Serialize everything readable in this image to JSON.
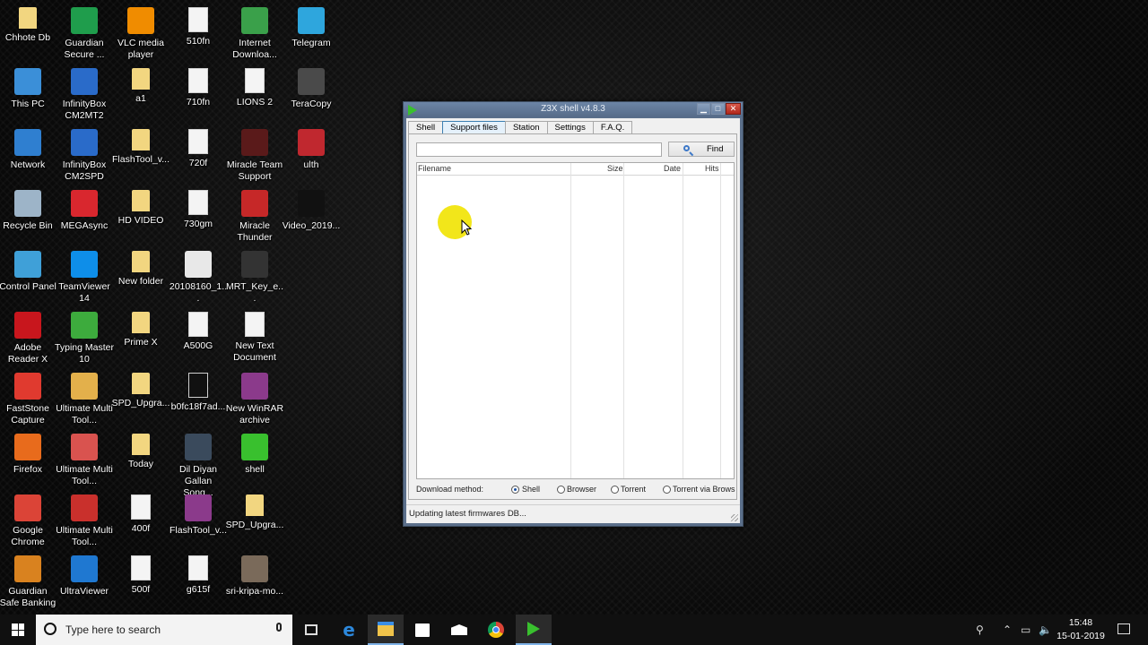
{
  "desktop": {
    "icons": [
      {
        "label": "Chhote Db",
        "icon": "folder-user-icon",
        "color": "#f2d680"
      },
      {
        "label": "This PC",
        "icon": "this-pc-icon",
        "color": "#3b8fd8"
      },
      {
        "label": "Network",
        "icon": "network-icon",
        "color": "#2f7fd0"
      },
      {
        "label": "Recycle Bin",
        "icon": "recycle-bin-icon",
        "color": "#9db4c8"
      },
      {
        "label": "Control Panel",
        "icon": "control-panel-icon",
        "color": "#3fa0d8"
      },
      {
        "label": "Adobe Reader X",
        "icon": "adobe-reader-icon",
        "color": "#c8161d"
      },
      {
        "label": "FastStone Capture",
        "icon": "faststone-icon",
        "color": "#e03a2f"
      },
      {
        "label": "Firefox",
        "icon": "firefox-icon",
        "color": "#e86b1c"
      },
      {
        "label": "Google Chrome",
        "icon": "chrome-icon",
        "color": "#db4437"
      },
      {
        "label": "Guardian Safe Banking",
        "icon": "guardian-banking-icon",
        "color": "#d9821f"
      },
      {
        "label": "Guardian Secure ...",
        "icon": "guardian-secure-icon",
        "color": "#1f9d4c"
      },
      {
        "label": "InfinityBox CM2MT2",
        "icon": "infinitybox-icon",
        "color": "#2a6bc9"
      },
      {
        "label": "InfinityBox CM2SPD",
        "icon": "infinitybox-icon",
        "color": "#2a6bc9"
      },
      {
        "label": "MEGAsync",
        "icon": "megasync-icon",
        "color": "#d9272e"
      },
      {
        "label": "TeamViewer 14",
        "icon": "teamviewer-icon",
        "color": "#0e8ee9"
      },
      {
        "label": "Typing Master 10",
        "icon": "typing-master-icon",
        "color": "#3dab3d"
      },
      {
        "label": "Ultimate Multi Tool...",
        "icon": "ultimate-multi-tool-icon",
        "color": "#e3b04b"
      },
      {
        "label": "Ultimate Multi Tool...",
        "icon": "ultimate-multi-tool-icon",
        "color": "#d9534f"
      },
      {
        "label": "Ultimate Multi Tool...",
        "icon": "ultimate-multi-tool-icon",
        "color": "#c9302c"
      },
      {
        "label": "UltraViewer",
        "icon": "ultraviewer-icon",
        "color": "#1f78d1"
      },
      {
        "label": "VLC media player",
        "icon": "vlc-icon",
        "color": "#f08c00"
      },
      {
        "label": "a1",
        "icon": "folder-icon",
        "color": "#f2d680"
      },
      {
        "label": "FlashTool_v...",
        "icon": "folder-icon",
        "color": "#f2d680"
      },
      {
        "label": "HD VIDEO",
        "icon": "folder-icon",
        "color": "#f2d680"
      },
      {
        "label": "New folder",
        "icon": "folder-icon",
        "color": "#f2d680"
      },
      {
        "label": "Prime X",
        "icon": "folder-icon",
        "color": "#f2d680"
      },
      {
        "label": "SPD_Upgra...",
        "icon": "folder-icon",
        "color": "#f2d680"
      },
      {
        "label": "Today",
        "icon": "folder-icon",
        "color": "#f2d680"
      },
      {
        "label": "400f",
        "icon": "file-icon",
        "color": "#f4f4f4"
      },
      {
        "label": "500f",
        "icon": "file-icon",
        "color": "#f4f4f4"
      },
      {
        "label": "510fn",
        "icon": "file-icon",
        "color": "#f4f4f4"
      },
      {
        "label": "710fn",
        "icon": "file-icon",
        "color": "#f4f4f4"
      },
      {
        "label": "720f",
        "icon": "file-icon",
        "color": "#f4f4f4"
      },
      {
        "label": "730gm",
        "icon": "file-icon",
        "color": "#f4f4f4"
      },
      {
        "label": "20108160_1...",
        "icon": "image-file-icon",
        "color": "#e8e8e8"
      },
      {
        "label": "A500G",
        "icon": "file-icon",
        "color": "#f4f4f4"
      },
      {
        "label": "b0fc18f7ad...",
        "icon": "file-icon",
        "color": "#111111"
      },
      {
        "label": "Dil Diyan Gallan Song...",
        "icon": "video-file-icon",
        "color": "#3a4a5c"
      },
      {
        "label": "FlashTool_v...",
        "icon": "winrar-icon",
        "color": "#8b3a8b"
      },
      {
        "label": "g615f",
        "icon": "file-icon",
        "color": "#f4f4f4"
      },
      {
        "label": "Internet Downloa...",
        "icon": "idm-icon",
        "color": "#3aa04a"
      },
      {
        "label": "LIONS 2",
        "icon": "file-icon",
        "color": "#f4f4f4"
      },
      {
        "label": "Miracle Team Support",
        "icon": "miracle-icon",
        "color": "#5a1a1a"
      },
      {
        "label": "Miracle Thunder",
        "icon": "miracle-thunder-icon",
        "color": "#c62828"
      },
      {
        "label": "MRT_Key_e...",
        "icon": "mrt-key-icon",
        "color": "#333333"
      },
      {
        "label": "New Text Document",
        "icon": "text-file-icon",
        "color": "#f4f4f4"
      },
      {
        "label": "New WinRAR archive",
        "icon": "winrar-icon",
        "color": "#8b3a8b"
      },
      {
        "label": "shell",
        "icon": "shell-icon",
        "color": "#39c02e"
      },
      {
        "label": "SPD_Upgra...",
        "icon": "zip-folder-icon",
        "color": "#f2d680"
      },
      {
        "label": "sri-kripa-mo...",
        "icon": "image-file-icon",
        "color": "#7a6a5a"
      },
      {
        "label": "Telegram",
        "icon": "telegram-icon",
        "color": "#2ea6dd"
      },
      {
        "label": "TeraCopy",
        "icon": "teracopy-icon",
        "color": "#4a4a4a"
      },
      {
        "label": "ulth",
        "icon": "ulth-icon",
        "color": "#c0282f"
      },
      {
        "label": "Video_2019...",
        "icon": "video-file-icon",
        "color": "#111111"
      }
    ]
  },
  "window": {
    "title": "Z3X shell v4.8.3",
    "tabs": [
      {
        "label": "Shell",
        "active": false
      },
      {
        "label": "Support files",
        "active": true
      },
      {
        "label": "Station",
        "active": false
      },
      {
        "label": "Settings",
        "active": false
      },
      {
        "label": "F.A.Q.",
        "active": false
      }
    ],
    "search": {
      "value": "",
      "find_label": "Find"
    },
    "columns": [
      "Filename",
      "Size",
      "Date",
      "Hits"
    ],
    "download_label": "Download method:",
    "download_options": [
      {
        "label": "Shell",
        "selected": true
      },
      {
        "label": "Browser",
        "selected": false
      },
      {
        "label": "Torrent",
        "selected": false
      },
      {
        "label": "Torrent via Brows",
        "selected": false
      }
    ],
    "status": "Updating latest firmwares DB..."
  },
  "taskbar": {
    "search_placeholder": "Type here to search",
    "time": "15:48",
    "date": "15-01-2019"
  },
  "colors": {
    "accent": "#3c7fb1",
    "highlight": "#f2e61a",
    "shell_green": "#39c02e"
  }
}
